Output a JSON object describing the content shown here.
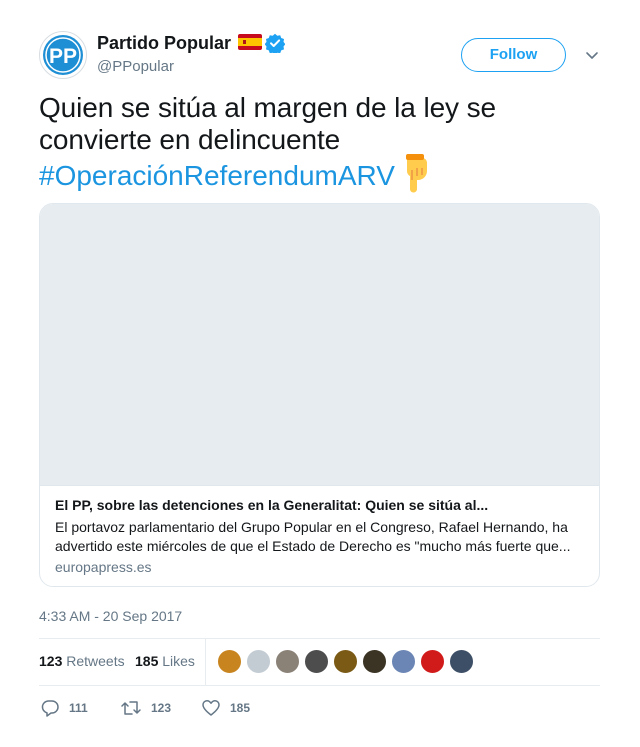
{
  "author": {
    "name": "Partido Popular",
    "handle": "@PPopular",
    "avatar_text": "PP",
    "flag_icon": "spain-flag-emoji",
    "verified_icon": "verified-badge-icon",
    "follow_label": "Follow",
    "menu_icon": "chevron-down-icon"
  },
  "tweet": {
    "text": "Quien se sitúa al margen de la ley se convierte en delincuente",
    "hashtag": "#OperaciónReferendumARV",
    "emoji_icon": "backhand-index-pointing-down-emoji"
  },
  "card": {
    "title": "El PP, sobre las detenciones en la Generalitat: Quien se sitúa al...",
    "description": "El portavoz parlamentario del Grupo Popular en el Congreso, Rafael Hernando, ha advertido este miércoles de que el Estado de Derecho es \"mucho más fuerte que...",
    "domain": "europapress.es"
  },
  "timestamp": "4:33 AM - 20 Sep 2017",
  "stats": {
    "retweets_count": "123",
    "retweets_label": "Retweets",
    "likes_count": "185",
    "likes_label": "Likes"
  },
  "liker_avatars": [
    {
      "name": "liker-avatar-1",
      "color": "#c8841e"
    },
    {
      "name": "liker-avatar-2",
      "color": "#c3ccd3"
    },
    {
      "name": "liker-avatar-3",
      "color": "#8a8177"
    },
    {
      "name": "liker-avatar-4",
      "color": "#4d4d4d"
    },
    {
      "name": "liker-avatar-5",
      "color": "#7a5a14"
    },
    {
      "name": "liker-avatar-6",
      "color": "#3b3424"
    },
    {
      "name": "liker-avatar-7",
      "color": "#6b86b5"
    },
    {
      "name": "liker-avatar-8",
      "color": "#d11a1a"
    },
    {
      "name": "liker-avatar-9",
      "color": "#3d4f66"
    }
  ],
  "actions": {
    "reply_count": "111",
    "retweet_count": "123",
    "like_count": "185"
  },
  "colors": {
    "accent": "#1da1f2",
    "hashtag": "#1b95e0",
    "muted": "#657786",
    "text": "#14171a",
    "border": "#e1e8ed",
    "pp_blue": "#1e8fd5"
  }
}
